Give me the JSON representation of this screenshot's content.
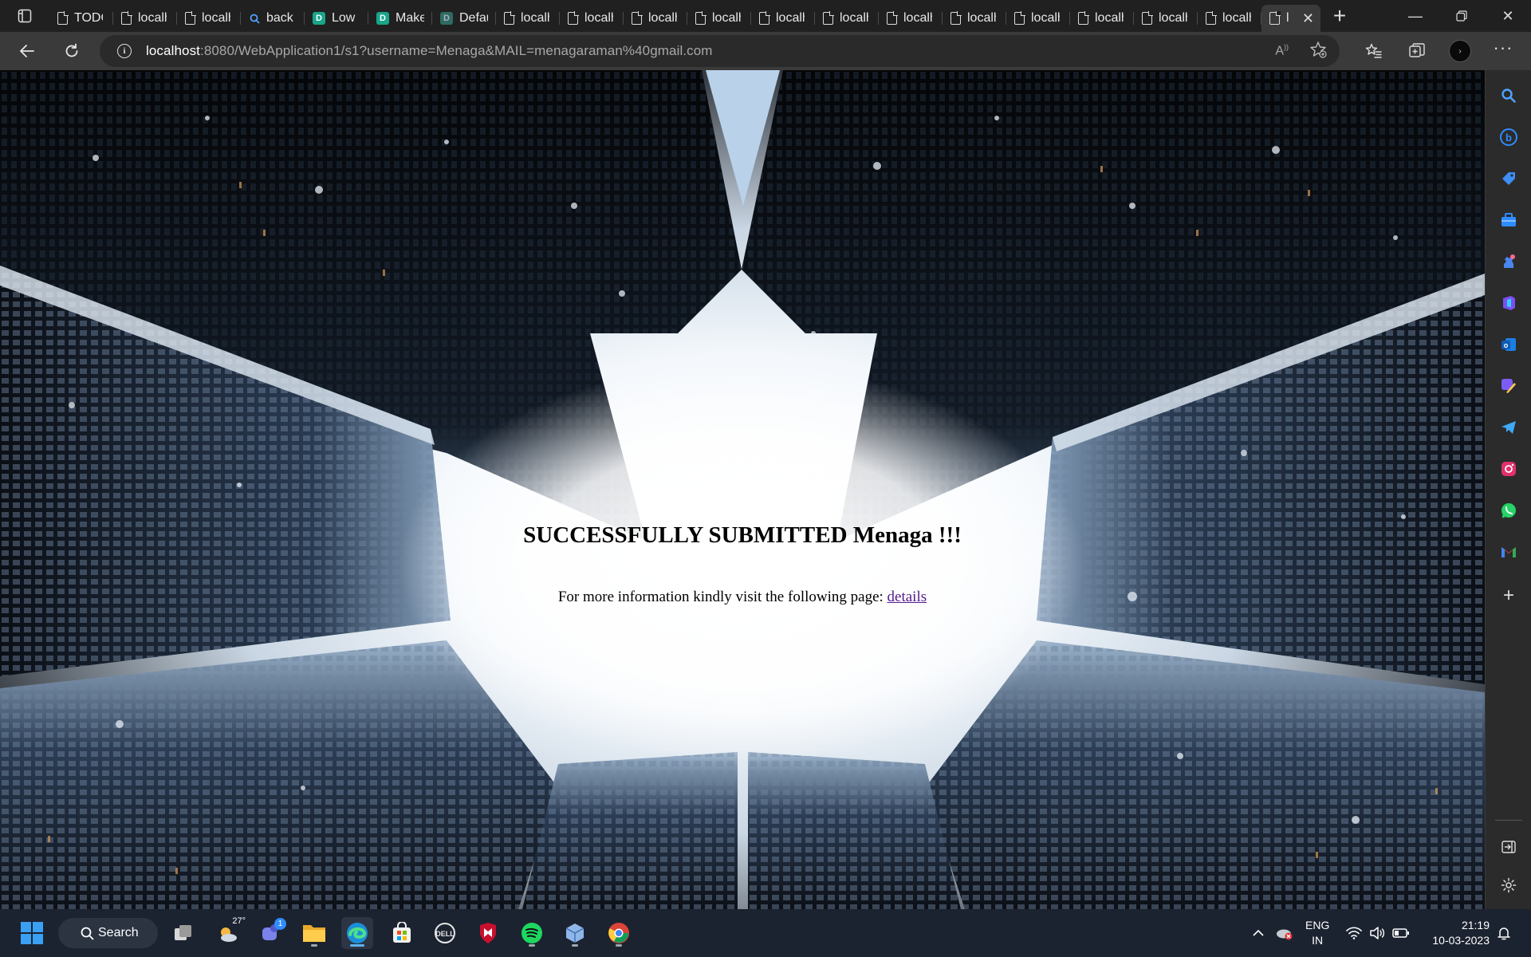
{
  "browser": {
    "tabs": [
      {
        "title": "TODO",
        "icon": "doc-icon"
      },
      {
        "title": "localhost",
        "icon": "doc-icon"
      },
      {
        "title": "localhost",
        "icon": "doc-icon"
      },
      {
        "title": "back",
        "icon": "search-icon"
      },
      {
        "title": "Low",
        "icon": "doc-green-icon"
      },
      {
        "title": "Make",
        "icon": "doc-green-icon"
      },
      {
        "title": "Default",
        "icon": "doc-green-icon"
      },
      {
        "title": "localhost",
        "icon": "doc-icon"
      },
      {
        "title": "localhost",
        "icon": "doc-icon"
      },
      {
        "title": "localhost",
        "icon": "doc-icon"
      },
      {
        "title": "localhost",
        "icon": "doc-icon"
      },
      {
        "title": "localhost",
        "icon": "doc-icon"
      },
      {
        "title": "localhost",
        "icon": "doc-icon"
      },
      {
        "title": "localhost",
        "icon": "doc-icon"
      },
      {
        "title": "localhost",
        "icon": "doc-icon"
      },
      {
        "title": "localhost",
        "icon": "doc-icon"
      },
      {
        "title": "localhost",
        "icon": "doc-icon"
      },
      {
        "title": "localhost",
        "icon": "doc-icon"
      },
      {
        "title": "localhost",
        "icon": "doc-icon"
      }
    ],
    "active_tab_title": "l",
    "url_host": "localhost",
    "url_rest": ":8080/WebApplication1/s1?username=Menaga&MAIL=menagaraman%40gmail.com",
    "profile_label": "›"
  },
  "page": {
    "heading": "SUCCESSFULLY SUBMITTED Menaga !!!",
    "info_text": "For more information kindly visit the following page: ",
    "link_text": "details",
    "link_color": "#551a8b"
  },
  "sidebar": {
    "icons": [
      "search-icon",
      "bing-chat-icon",
      "shopping-tag-icon",
      "tools-icon",
      "games-icon",
      "office-icon",
      "outlook-icon",
      "designer-icon",
      "telegram-icon",
      "instagram-icon",
      "whatsapp-icon",
      "gmail-icon",
      "add-icon",
      "hide-sidebar-icon",
      "settings-icon"
    ]
  },
  "taskbar": {
    "search_label": "Search",
    "weather_temp": "27°",
    "teams_badge": "1",
    "language_line1": "ENG",
    "language_line2": "IN",
    "time": "21:19",
    "date": "10-03-2023",
    "accent": "#5fb2f2"
  }
}
